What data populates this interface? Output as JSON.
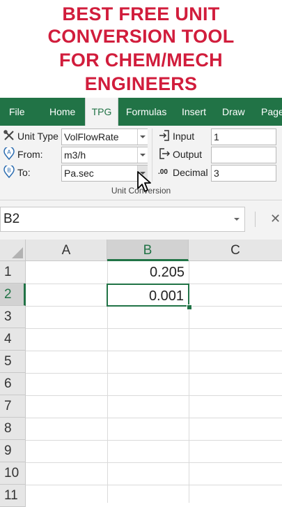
{
  "promo": {
    "line1": "BEST FREE UNIT",
    "line2": "CONVERSION TOOL",
    "line3": "FOR CHEM/MECH",
    "line4": "ENGINEERS"
  },
  "ribbon_tabs": [
    "File",
    "Home",
    "TPG",
    "Formulas",
    "Insert",
    "Draw",
    "Page"
  ],
  "unit_conversion": {
    "unit_type_label": "Unit Type",
    "unit_type_value": "VolFlowRate",
    "from_label": "From:",
    "from_value": "m3/h",
    "to_label": "To:",
    "to_value": "Pa.sec",
    "input_label": "Input",
    "input_value": "1",
    "output_label": "Output",
    "output_value": "",
    "decimal_label": "Decimal",
    "decimal_icon_text": ".00",
    "decimal_value": "3",
    "group_caption": "Unit Conversion"
  },
  "formula_bar": {
    "name_box": "B2",
    "cancel_glyph": "✕"
  },
  "sheet": {
    "columns": [
      "A",
      "B",
      "C"
    ],
    "rows": [
      "1",
      "2",
      "3",
      "4",
      "5",
      "6",
      "7",
      "8",
      "9",
      "10",
      "11"
    ],
    "cells": {
      "B1": "0.205",
      "B2": "0.001"
    },
    "active_cell": "B2"
  },
  "colors": {
    "accent": "#217346",
    "promo_red": "#d11d3c"
  }
}
